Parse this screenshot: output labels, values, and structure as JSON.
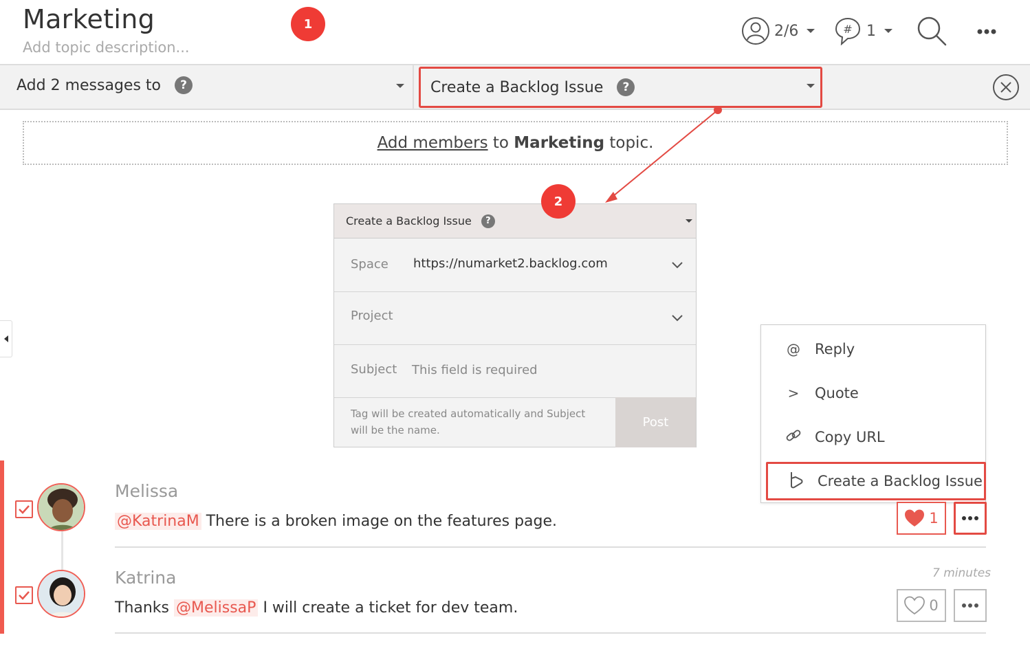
{
  "header": {
    "title": "Marketing",
    "description_placeholder": "Add topic description...",
    "badge_1": "1",
    "members_count": "2/6",
    "tags_count": "1"
  },
  "action_bar": {
    "add_messages_label": "Add 2 messages to",
    "help_symbol": "?",
    "integration_label": "Create a Backlog Issue"
  },
  "add_members": {
    "link_text": "Add members",
    "middle_text": "to",
    "topic_name": "Marketing",
    "end_text": "topic."
  },
  "badge_2": "2",
  "backlog_form": {
    "title": "Create a Backlog Issue",
    "space_label": "Space",
    "space_value": "https://numarket2.backlog.com",
    "project_label": "Project",
    "subject_label": "Subject",
    "subject_placeholder": "This field is required",
    "note": "Tag will be created automatically and Subject will be the name.",
    "post_label": "Post"
  },
  "context_menu": {
    "items": [
      {
        "icon": "@",
        "label": "Reply"
      },
      {
        "icon": ">",
        "label": "Quote"
      },
      {
        "icon": "link-icon",
        "label": "Copy URL"
      },
      {
        "icon": "backlog-icon",
        "label": "Create a Backlog Issue"
      }
    ]
  },
  "messages": [
    {
      "author": "Melissa",
      "mention": "@KatrinaM",
      "text": "There is a broken image on the features page.",
      "likes": "1",
      "liked": true
    },
    {
      "author": "Katrina",
      "prefix": "Thanks",
      "mention": "@MelissaP",
      "text": "I will create a ticket for dev team.",
      "likes": "0",
      "liked": false,
      "timestamp": "7 minutes"
    }
  ],
  "colors": {
    "accent": "#e34a43",
    "badge": "#ef3b35",
    "mention_bg": "#fdecea"
  }
}
